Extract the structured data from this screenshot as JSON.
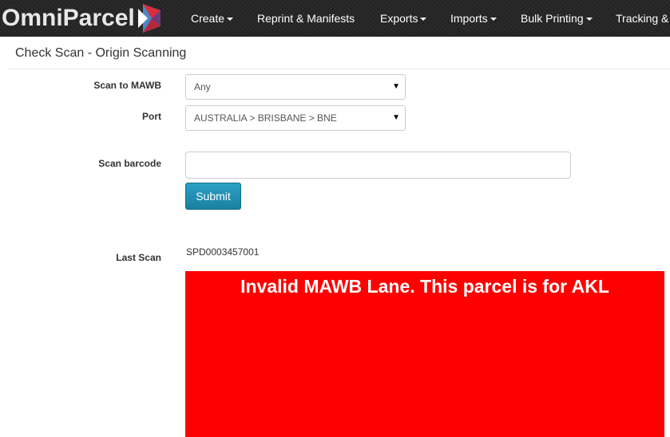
{
  "navbar": {
    "brand": "OmniParcel",
    "items": [
      {
        "label": "Create",
        "dropdown": true
      },
      {
        "label": "Reprint & Manifests",
        "dropdown": false
      },
      {
        "label": "Exports",
        "dropdown": true
      },
      {
        "label": "Imports",
        "dropdown": true
      },
      {
        "label": "Bulk Printing",
        "dropdown": true
      },
      {
        "label": "Tracking &",
        "dropdown": false
      }
    ]
  },
  "page": {
    "title": "Check Scan - Origin Scanning"
  },
  "form": {
    "mawb_label": "Scan to MAWB",
    "mawb_value": "Any",
    "port_label": "Port",
    "port_value": "AUSTRALIA > BRISBANE > BNE",
    "barcode_label": "Scan barcode",
    "barcode_value": "",
    "submit_label": "Submit",
    "dropdown_arrow": "▼"
  },
  "last_scan": {
    "label": "Last Scan",
    "value": "SPD0003457001",
    "message": "Invalid MAWB Lane. This parcel is for AKL",
    "alert_color": "#ff0000"
  },
  "colors": {
    "navbar_bg": "#222222",
    "submit_bg": "#1f8fb5",
    "logo_red": "#d62e3a",
    "logo_blue": "#3d6ea8",
    "logo_purple": "#6b3b7a"
  }
}
